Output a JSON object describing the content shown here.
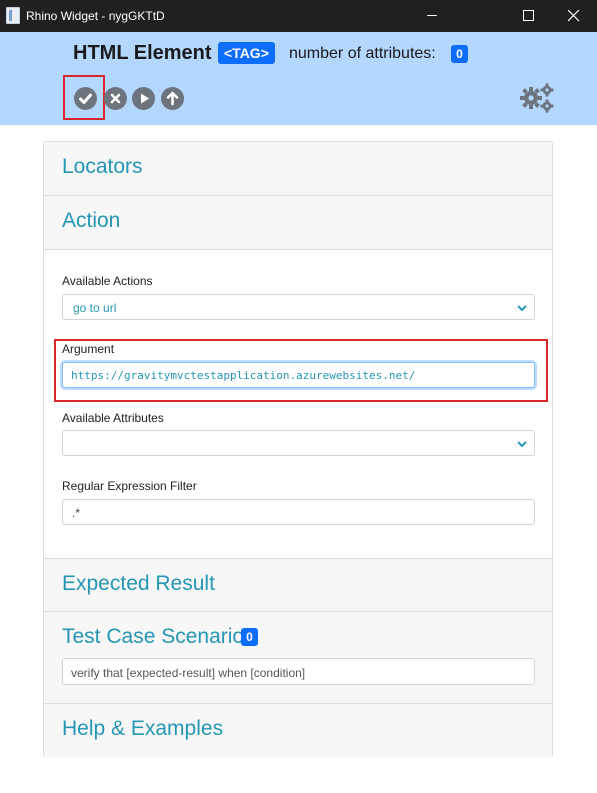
{
  "window": {
    "title": "Rhino Widget - nygGKTtD"
  },
  "header": {
    "title": "HTML Element",
    "tag_badge": "<TAG>",
    "attributes_label": "number of attributes:",
    "attributes_count": "0",
    "toolbar_icons": [
      "check-icon",
      "cancel-icon",
      "play-icon",
      "arrow-up-icon"
    ],
    "settings_icon": "gears-icon"
  },
  "sections": {
    "locators": "Locators",
    "action": "Action",
    "expected_result": "Expected Result",
    "test_case_scenario": "Test Case Scenario",
    "scenario_count": "0",
    "help": "Help & Examples"
  },
  "form": {
    "available_actions_label": "Available Actions",
    "available_actions_value": "go to url",
    "argument_label": "Argument",
    "argument_value": "https://gravitymvctestapplication.azurewebsites.net/",
    "available_attributes_label": "Available Attributes",
    "available_attributes_value": "",
    "regex_label": "Regular Expression Filter",
    "regex_value": ".*",
    "scenario_placeholder": "verify that [expected-result] when [condition]"
  },
  "colors": {
    "header_bg": "#b3d7ff",
    "accent": "#2596b4",
    "badge": "#0d6efd",
    "highlight": "#d9262b"
  }
}
